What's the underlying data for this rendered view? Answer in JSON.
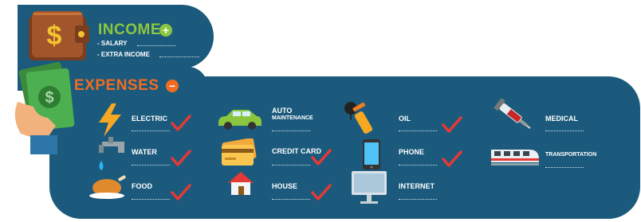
{
  "income": {
    "title": "INCOME",
    "items": [
      "- SALARY",
      "- EXTRA INCOME"
    ]
  },
  "expenses": {
    "title": "EXPENSES",
    "items": [
      {
        "label": "ELECTRIC",
        "icon": "lightning-icon",
        "checked": true
      },
      {
        "label": "WATER",
        "icon": "water-tap-icon",
        "checked": true
      },
      {
        "label": "FOOD",
        "icon": "roast-chicken-icon",
        "checked": true
      },
      {
        "label": "AUTO",
        "label2": "MAINTENANCE",
        "icon": "car-icon",
        "checked": false
      },
      {
        "label": "CREDIT CARD",
        "icon": "credit-card-icon",
        "checked": true
      },
      {
        "label": "HOUSE",
        "icon": "house-icon",
        "checked": true
      },
      {
        "label": "OIL",
        "icon": "fuel-pump-icon",
        "checked": true
      },
      {
        "label": "PHONE",
        "icon": "smartphone-icon",
        "checked": true
      },
      {
        "label": "INTERNET",
        "icon": "monitor-icon",
        "checked": false
      },
      {
        "label": "MEDICAL",
        "icon": "syringe-icon",
        "checked": false
      },
      {
        "label": "TRANSPORTATION",
        "icon": "train-icon",
        "checked": false
      }
    ]
  },
  "colors": {
    "panel": "#1b5a7c",
    "income": "#8cc63f",
    "expenses": "#f26b21",
    "check": "#e53935"
  }
}
